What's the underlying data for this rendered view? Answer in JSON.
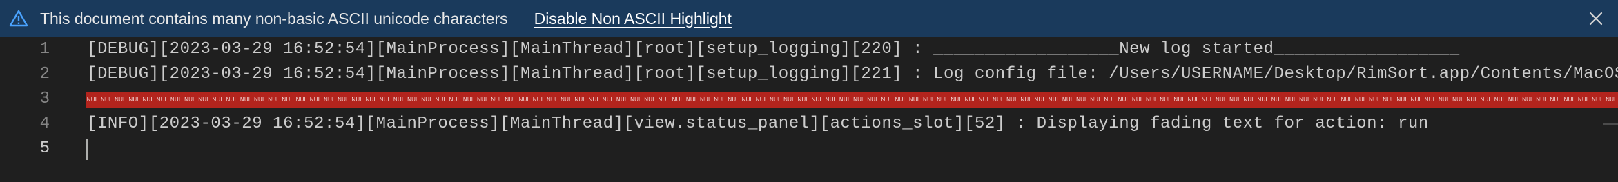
{
  "banner": {
    "message": "This document contains many non-basic ASCII unicode characters",
    "link_label": "Disable Non ASCII Highlight",
    "warning_icon": "warning-triangle-icon",
    "close_icon": "close-icon",
    "background": "#1a3a5c",
    "icon_color": "#4aa3ff"
  },
  "editor": {
    "current_line": 5,
    "lines": [
      {
        "number": "1",
        "text": "[DEBUG][2023-03-29 16:52:54][MainProcess][MainThread][root][setup_logging][220] : __________________New log started__________________"
      },
      {
        "number": "2",
        "text": "[DEBUG][2023-03-29 16:52:54][MainProcess][MainThread][root][setup_logging][221] : Log config file: /Users/USERNAME/Desktop/RimSort.app/Contents/MacOS/data/logger_config.yaml"
      },
      {
        "number": "3",
        "nul_label": "NUL",
        "nul_color": "#b3241d"
      },
      {
        "number": "4",
        "text": "[INFO][2023-03-29 16:52:54][MainProcess][MainThread][view.status_panel][actions_slot][52] : Displaying fading text for action: run"
      },
      {
        "number": "5",
        "text": ""
      }
    ]
  }
}
